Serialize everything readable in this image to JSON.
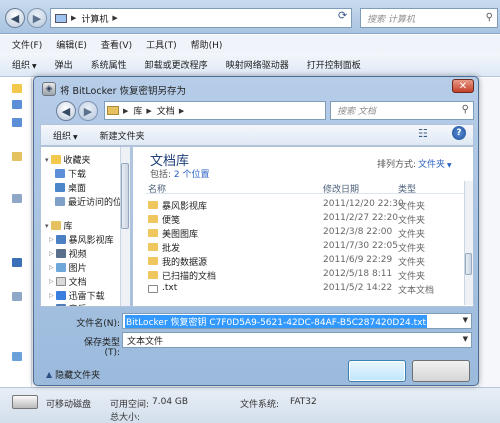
{
  "explorer": {
    "address": [
      "计算机"
    ],
    "search_placeholder": "搜索 计算机",
    "menu": [
      "文件(F)",
      "编辑(E)",
      "查看(V)",
      "工具(T)",
      "帮助(H)"
    ],
    "toolbar": [
      "组织",
      "弹出",
      "系统属性",
      "卸载或更改程序",
      "映射网络驱动器",
      "打开控制面板"
    ],
    "status": {
      "drive_label": "可移动磁盘",
      "free_label": "可用空间:",
      "free_value": "7.04 GB",
      "total_label": "总大小:",
      "fs_label": "文件系统:",
      "fs_value": "FAT32"
    }
  },
  "dialog": {
    "title": "将 BitLocker 恢复密钥另存为",
    "address": [
      "库",
      "文档"
    ],
    "search_placeholder": "搜索 文档",
    "commands": [
      "组织",
      "新建文件夹"
    ],
    "nav": {
      "favorites_header": "收藏夹",
      "favorites": [
        "下载",
        "桌面",
        "最近访问的位置"
      ],
      "libraries_header": "库",
      "libraries": [
        "暴风影视库",
        "视频",
        "图片",
        "文档",
        "迅雷下载",
        "音乐"
      ]
    },
    "library": {
      "title": "文档库",
      "includes_label": "包括:",
      "includes_link": "2 个位置",
      "arrange_label": "排列方式:",
      "arrange_value": "文件夹"
    },
    "columns": [
      "名称",
      "修改日期",
      "类型"
    ],
    "files": [
      {
        "name": "暴风影视库",
        "date": "2011/12/20 22:30",
        "type": "文件夹"
      },
      {
        "name": "便笺",
        "date": "2011/2/27 22:20",
        "type": "文件夹"
      },
      {
        "name": "美图图库",
        "date": "2012/3/8 22:00",
        "type": "文件夹"
      },
      {
        "name": "批发",
        "date": "2011/7/30 22:05",
        "type": "文件夹"
      },
      {
        "name": "我的数据源",
        "date": "2011/6/9 22:29",
        "type": "文件夹"
      },
      {
        "name": "已扫描的文档",
        "date": "2012/5/18 8:11",
        "type": "文件夹"
      },
      {
        "name": ".txt",
        "date": "2011/5/2 14:22",
        "type": "文本文档"
      }
    ],
    "filename_label": "文件名(N):",
    "filename_value": "BitLocker 恢复密钥 C7F0D5A9-5621-42DC-84AF-B5C287420D24.txt",
    "filetype_label": "保存类型(T):",
    "filetype_value": "文本文件",
    "hide_folders_label": "隐藏文件夹",
    "save_label": "",
    "cancel_label": ""
  },
  "colors": {
    "accent": "#3399ff",
    "title_blue": "#1e3f78",
    "link": "#2b62c4"
  }
}
